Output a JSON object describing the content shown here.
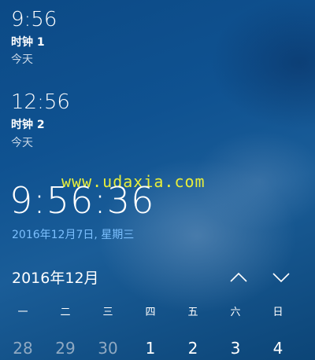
{
  "clocks": [
    {
      "time": "9:56",
      "name": "时钟 1",
      "day": "今天"
    },
    {
      "time": "12:56",
      "name": "时钟 2",
      "day": "今天"
    }
  ],
  "watermark": "www.udaxia.com",
  "current": {
    "time": "9:56:36",
    "date": "2016年12月7日, 星期三"
  },
  "calendar": {
    "month_label": "2016年12月",
    "prev_icon": "chevron-up-icon",
    "next_icon": "chevron-down-icon",
    "weekdays": [
      "一",
      "二",
      "三",
      "四",
      "五",
      "六",
      "日"
    ],
    "days": [
      {
        "label": "28",
        "other_month": true
      },
      {
        "label": "29",
        "other_month": true
      },
      {
        "label": "30",
        "other_month": true
      },
      {
        "label": "1",
        "other_month": false
      },
      {
        "label": "2",
        "other_month": false
      },
      {
        "label": "3",
        "other_month": false
      },
      {
        "label": "4",
        "other_month": false
      }
    ]
  },
  "colors": {
    "background": "#0f5291",
    "date_accent": "#7cc0ff",
    "watermark": "#e8ee3a",
    "muted_text": "#c6d6e6"
  }
}
